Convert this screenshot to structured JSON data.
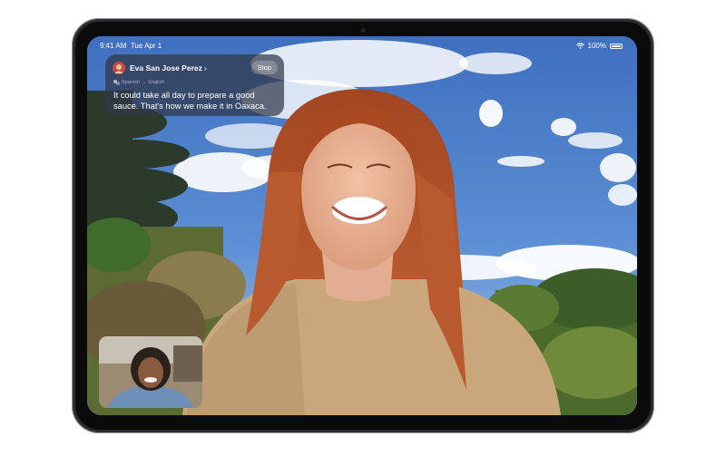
{
  "status_bar": {
    "time": "9:41 AM",
    "date": "Tue Apr 1",
    "battery": "100%",
    "battery_level": 1.0,
    "icons": [
      "wifi-icon",
      "battery-icon"
    ]
  },
  "live_translation": {
    "caller_name": "Eva San Jose Perez",
    "chevron": "›",
    "stop_label": "Stop",
    "source_language": "Spanish",
    "arrow": "→",
    "target_language": "English",
    "transcript": "It could take all day to prepare a good sauce. That's how we make it in Oaxaca."
  },
  "colors": {
    "sky": "#4a79c2",
    "banner": "#303848",
    "hair": "#b8572c",
    "sweater": "#c9a77b"
  }
}
